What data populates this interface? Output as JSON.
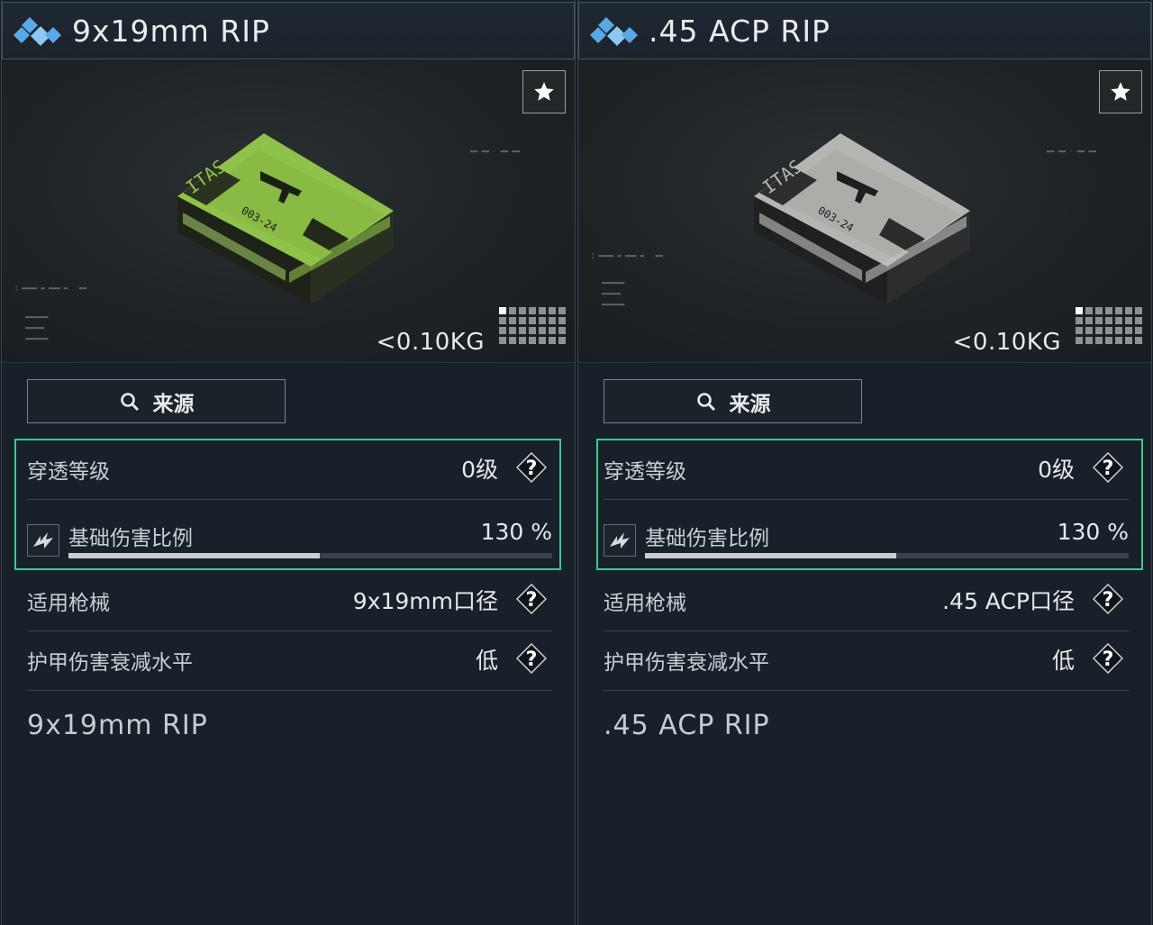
{
  "panels": [
    {
      "title": "9x19mm RIP",
      "box_color": "#8fc24a",
      "weight": "<0.10KG",
      "source_label": "来源",
      "penetration": {
        "label": "穿透等级",
        "value": "0级"
      },
      "base_damage": {
        "label": "基础伤害比例",
        "value": "130 %",
        "level": 0.52
      },
      "weapon": {
        "label": "适用枪械",
        "value": "9x19mm口径"
      },
      "armor_falloff": {
        "label": "护甲伤害衰减水平",
        "value": "低"
      },
      "description": "9x19mm RIP"
    },
    {
      "title": ".45 ACP RIP",
      "box_color": "#b5b5b2",
      "weight": "<0.10KG",
      "source_label": "来源",
      "penetration": {
        "label": "穿透等级",
        "value": "0级"
      },
      "base_damage": {
        "label": "基础伤害比例",
        "value": "130 %",
        "level": 0.52
      },
      "weapon": {
        "label": "适用枪械",
        "value": ".45 ACP口径"
      },
      "armor_falloff": {
        "label": "护甲伤害衰减水平",
        "value": "低"
      },
      "description": ".45 ACP RIP"
    }
  ],
  "icons": {
    "title": "diamond-cluster-icon",
    "favorite": "star-icon",
    "search": "search-icon",
    "help": "question-diamond-icon",
    "damage": "damage-icon",
    "grid": "inventory-grid-icon"
  },
  "colors": {
    "highlight": "#3ec98a",
    "diamond": "#5aa9e6"
  }
}
